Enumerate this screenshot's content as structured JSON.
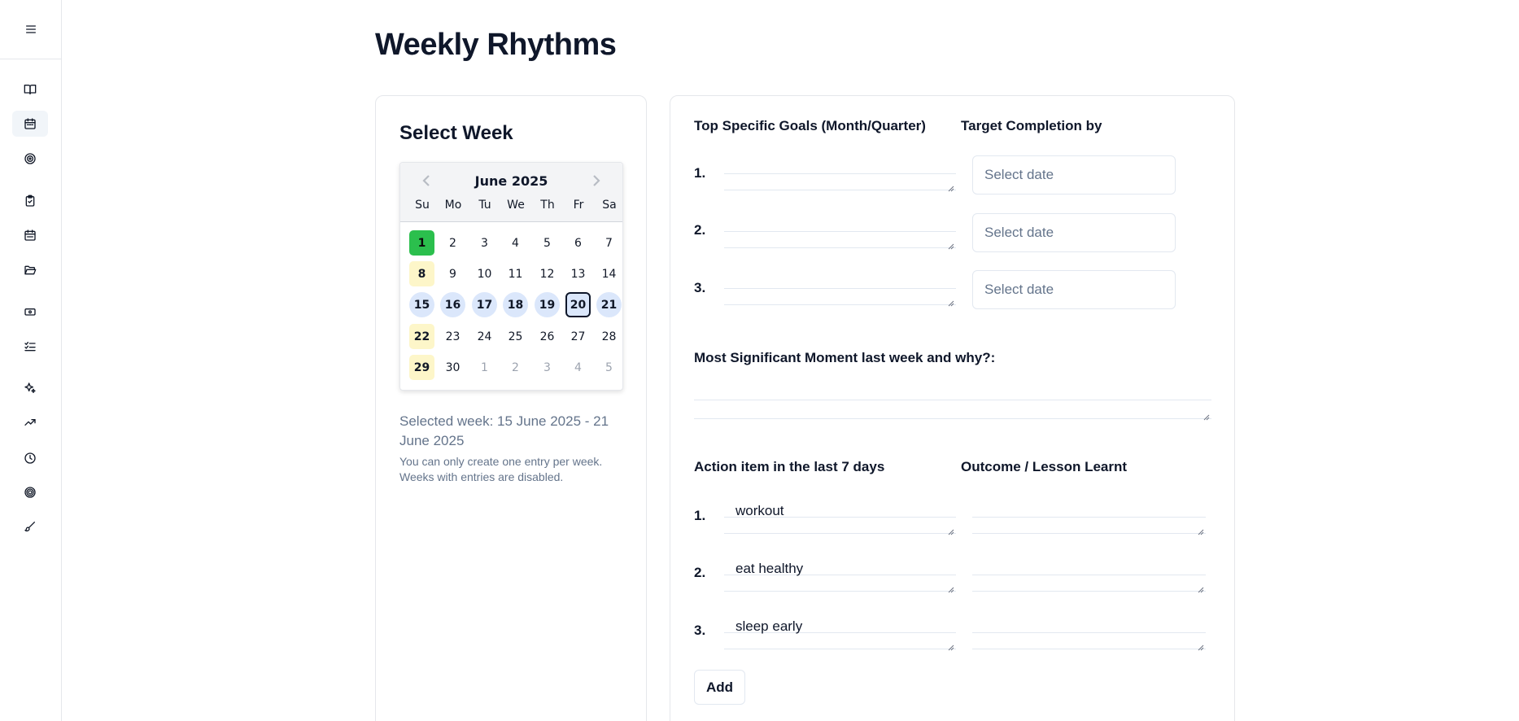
{
  "sidebar": {
    "items": [
      {
        "icon": "menu-icon"
      },
      {
        "icon": "book-open-icon"
      },
      {
        "icon": "calendar-icon",
        "active": true
      },
      {
        "icon": "target-icon"
      },
      {
        "icon": "clipboard-check-icon"
      },
      {
        "icon": "calendar-days-icon"
      },
      {
        "icon": "folder-open-icon"
      },
      {
        "icon": "banknote-icon"
      },
      {
        "icon": "list-checks-icon"
      },
      {
        "icon": "sparkles-icon"
      },
      {
        "icon": "trending-up-icon"
      },
      {
        "icon": "clock-icon"
      },
      {
        "icon": "crosshair-icon"
      },
      {
        "icon": "brush-icon"
      }
    ]
  },
  "page": {
    "title": "Weekly Rhythms"
  },
  "week_card": {
    "title": "Select Week",
    "calendar": {
      "month": "June 2025",
      "weekdays": [
        "Su",
        "Mo",
        "Tu",
        "We",
        "Th",
        "Fr",
        "Sa"
      ],
      "weeks": [
        [
          "1",
          "2",
          "3",
          "4",
          "5",
          "6",
          "7"
        ],
        [
          "8",
          "9",
          "10",
          "11",
          "12",
          "13",
          "14"
        ],
        [
          "15",
          "16",
          "17",
          "18",
          "19",
          "20",
          "21"
        ],
        [
          "22",
          "23",
          "24",
          "25",
          "26",
          "27",
          "28"
        ],
        [
          "29",
          "30",
          "1",
          "2",
          "3",
          "4",
          "5"
        ]
      ],
      "today_color": "#2bbf4d",
      "entry_color": "#fdf6c9",
      "selected_range_color": "#dbe7fb"
    },
    "selected_week": "Selected week: 15 June 2025 - 21 June 2025",
    "note_line1": "You can only create one entry per week.",
    "note_line2": "Weeks with entries are disabled."
  },
  "form": {
    "goals_label": "Top Specific Goals (Month/Quarter)",
    "target_label": "Target Completion by",
    "numbers": [
      "1.",
      "2.",
      "3."
    ],
    "date_placeholder": "Select date",
    "moment_label": "Most Significant Moment last week and why?:",
    "action_label": "Action item in the last 7 days",
    "outcome_label": "Outcome / Lesson Learnt",
    "actions": [
      "workout",
      "eat healthy",
      "sleep early"
    ],
    "add_label": "Add"
  }
}
